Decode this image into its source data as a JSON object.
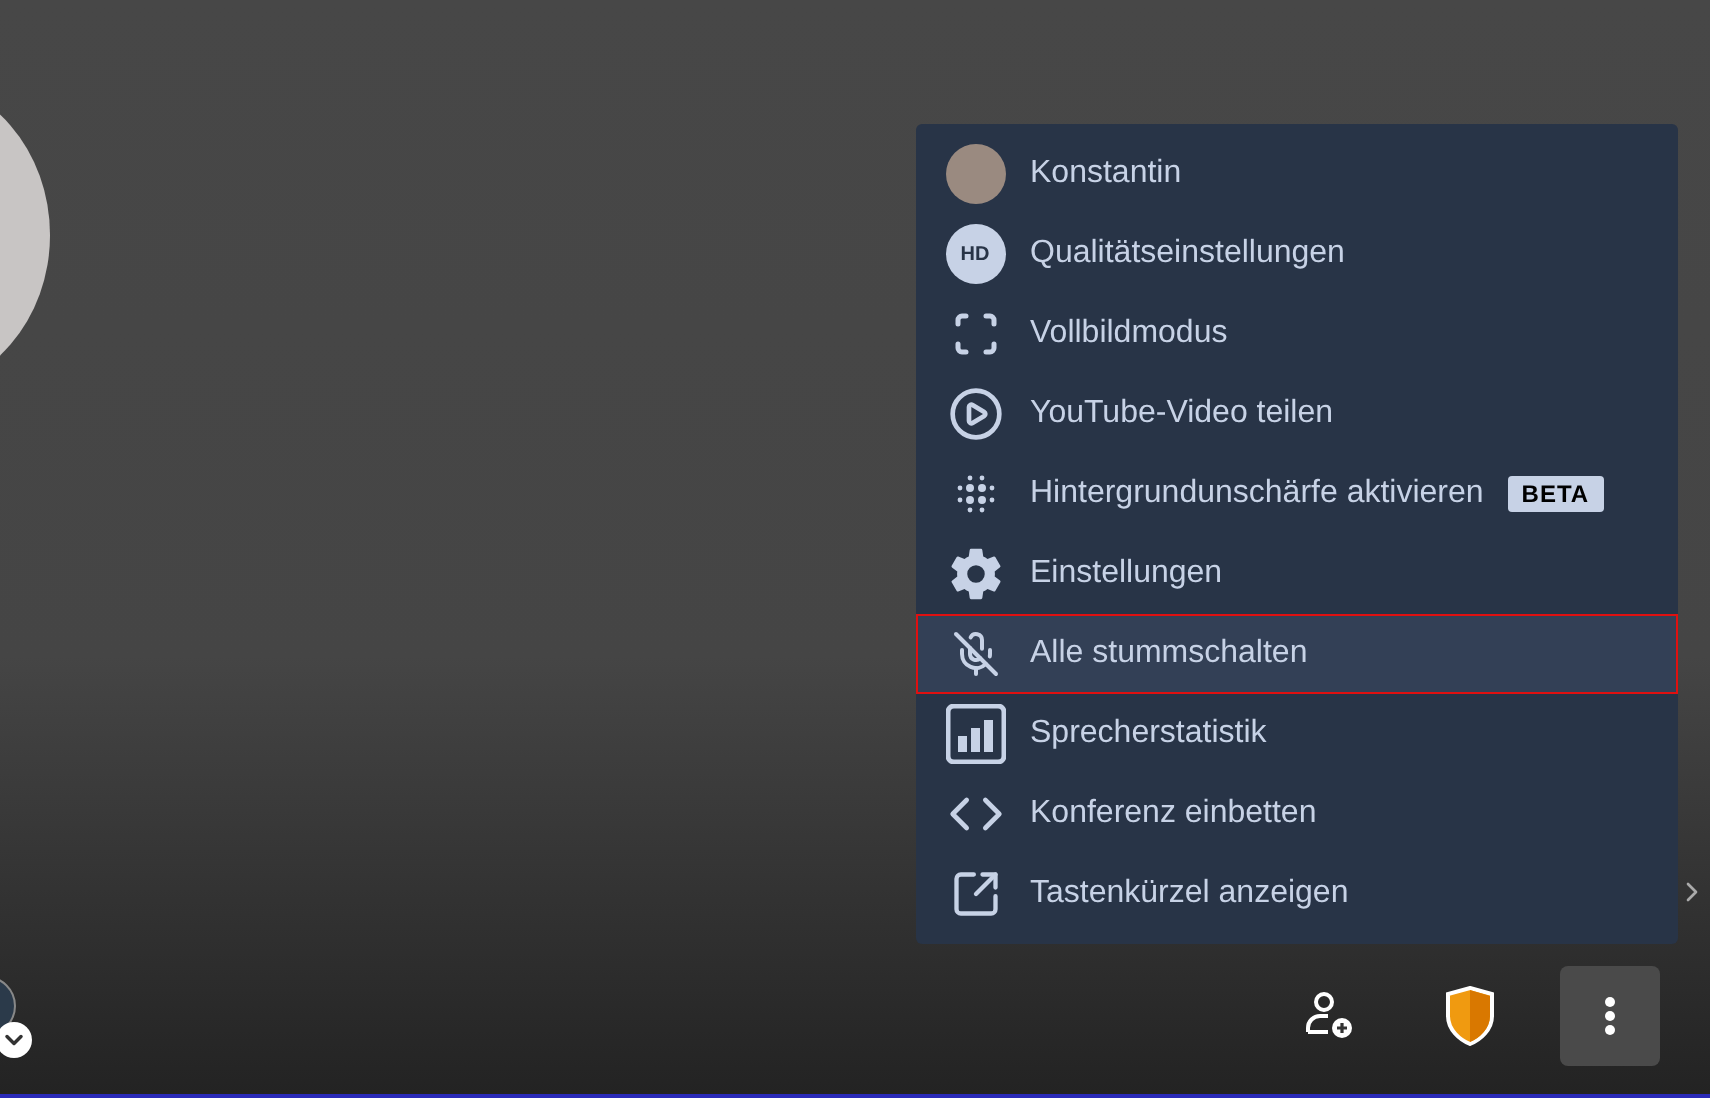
{
  "menu": {
    "items": [
      {
        "kind": "avatar",
        "label": "Konstantin",
        "selected": false
      },
      {
        "kind": "text-icon",
        "icon_text": "HD",
        "label": "Qualitätseinstellungen",
        "selected": false
      },
      {
        "kind": "fullscreen",
        "label": "Vollbildmodus",
        "selected": false
      },
      {
        "kind": "play",
        "label": "YouTube-Video teilen",
        "selected": false
      },
      {
        "kind": "blur",
        "label": "Hintergrundunschärfe aktivieren",
        "badge": "BETA",
        "selected": false
      },
      {
        "kind": "gear",
        "label": "Einstellungen",
        "selected": false
      },
      {
        "kind": "mute",
        "label": "Alle stummschalten",
        "selected": true
      },
      {
        "kind": "stats",
        "label": "Sprecherstatistik",
        "selected": false
      },
      {
        "kind": "embed",
        "label": "Konferenz einbetten",
        "selected": false
      },
      {
        "kind": "shortcut",
        "label": "Tastenkürzel anzeigen",
        "selected": false
      }
    ]
  }
}
